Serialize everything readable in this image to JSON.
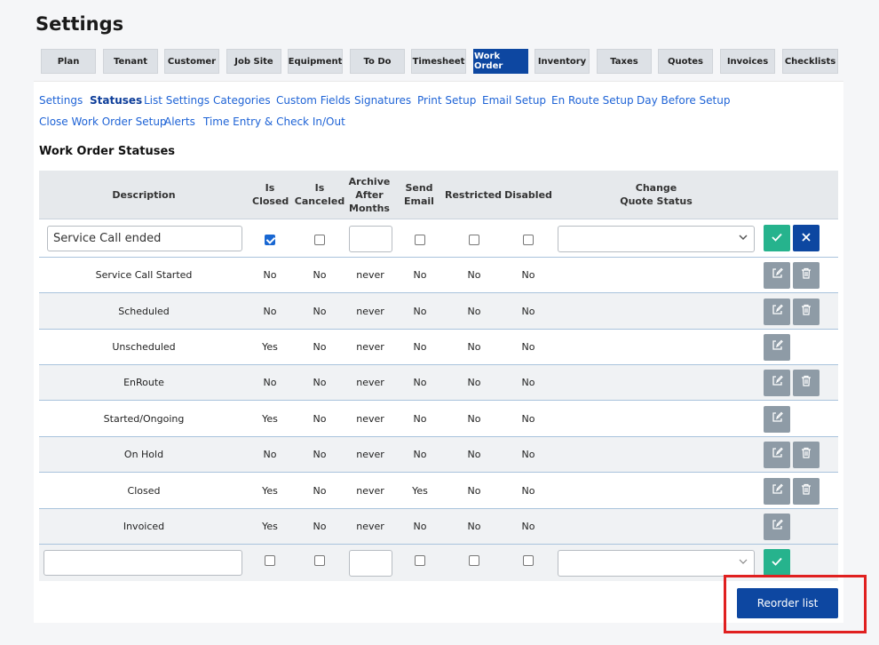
{
  "page_title": "Settings",
  "tabs": [
    {
      "label": "Plan",
      "active": false
    },
    {
      "label": "Tenant",
      "active": false
    },
    {
      "label": "Customer",
      "active": false
    },
    {
      "label": "Job Site",
      "active": false
    },
    {
      "label": "Equipment",
      "active": false
    },
    {
      "label": "To Do",
      "active": false
    },
    {
      "label": "Timesheet",
      "active": false
    },
    {
      "label": "Work Order",
      "active": true
    },
    {
      "label": "Inventory",
      "active": false
    },
    {
      "label": "Taxes",
      "active": false
    },
    {
      "label": "Quotes",
      "active": false
    },
    {
      "label": "Invoices",
      "active": false
    },
    {
      "label": "Checklists",
      "active": false
    }
  ],
  "sublinks": [
    {
      "label": "Settings"
    },
    {
      "label": "Statuses",
      "active": true
    },
    {
      "label": "List Settings"
    },
    {
      "label": "Categories"
    },
    {
      "label": "Custom Fields"
    },
    {
      "label": "Signatures"
    },
    {
      "label": "Print Setup"
    },
    {
      "label": "Email Setup"
    },
    {
      "label": "En Route Setup"
    },
    {
      "label": "Day Before Setup"
    },
    {
      "label": "Close Work Order Setup"
    },
    {
      "label": "Alerts"
    },
    {
      "label": "Time Entry & Check In/Out"
    }
  ],
  "section_title": "Work Order Statuses",
  "columns": {
    "description": "Description",
    "is_closed": [
      "Is",
      "Closed"
    ],
    "is_canceled": [
      "Is",
      "Canceled"
    ],
    "archive": [
      "Archive",
      "After",
      "Months"
    ],
    "send_email": [
      "Send",
      "Email"
    ],
    "restricted": "Restricted",
    "disabled": "Disabled",
    "change_quote": [
      "Change",
      "Quote Status"
    ]
  },
  "edit_row": {
    "description_value": "Service Call ended",
    "is_closed": true,
    "is_canceled": false,
    "archive_value": "",
    "send_email": false,
    "restricted": false,
    "disabled": false,
    "quote_status_value": ""
  },
  "rows": [
    {
      "description": "Service Call Started",
      "is_closed": "No",
      "is_canceled": "No",
      "archive": "never",
      "send_email": "No",
      "restricted": "No",
      "disabled": "No",
      "deletable": true
    },
    {
      "description": "Scheduled",
      "is_closed": "No",
      "is_canceled": "No",
      "archive": "never",
      "send_email": "No",
      "restricted": "No",
      "disabled": "No",
      "deletable": true
    },
    {
      "description": "Unscheduled",
      "is_closed": "Yes",
      "is_canceled": "No",
      "archive": "never",
      "send_email": "No",
      "restricted": "No",
      "disabled": "No",
      "deletable": false
    },
    {
      "description": "EnRoute",
      "is_closed": "No",
      "is_canceled": "No",
      "archive": "never",
      "send_email": "No",
      "restricted": "No",
      "disabled": "No",
      "deletable": true
    },
    {
      "description": "Started/Ongoing",
      "is_closed": "Yes",
      "is_canceled": "No",
      "archive": "never",
      "send_email": "No",
      "restricted": "No",
      "disabled": "No",
      "deletable": false
    },
    {
      "description": "On Hold",
      "is_closed": "No",
      "is_canceled": "No",
      "archive": "never",
      "send_email": "No",
      "restricted": "No",
      "disabled": "No",
      "deletable": true
    },
    {
      "description": "Closed",
      "is_closed": "Yes",
      "is_canceled": "No",
      "archive": "never",
      "send_email": "Yes",
      "restricted": "No",
      "disabled": "No",
      "deletable": true
    },
    {
      "description": "Invoiced",
      "is_closed": "Yes",
      "is_canceled": "No",
      "archive": "never",
      "send_email": "No",
      "restricted": "No",
      "disabled": "No",
      "deletable": false
    }
  ],
  "new_row": {
    "description_value": "",
    "archive_value": "",
    "quote_status_value": ""
  },
  "reorder_button": "Reorder list",
  "colors": {
    "primary": "#0d47a1",
    "success": "#26b38d",
    "neutral_button": "#8e9ba6",
    "highlight": "#e02020",
    "link": "#1e63d6"
  },
  "icons": {
    "confirm": "check-icon",
    "cancel": "close-icon",
    "edit": "edit-icon",
    "delete": "trash-icon",
    "dropdown": "chevron-down-icon"
  }
}
